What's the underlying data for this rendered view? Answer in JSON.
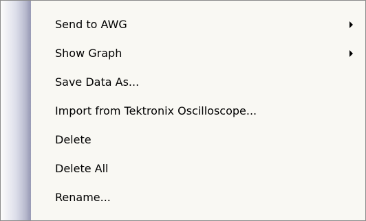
{
  "context_menu": {
    "items": [
      {
        "label": "Send to AWG",
        "has_submenu": true
      },
      {
        "label": "Show Graph",
        "has_submenu": true
      },
      {
        "label": "Save Data As..."
      },
      {
        "label": "Import from Tektronix Oscilloscope..."
      },
      {
        "label": "Delete"
      },
      {
        "label": "Delete All"
      },
      {
        "label": "Rename..."
      }
    ]
  },
  "icons": {
    "submenu_indicator": "chevron-right-icon"
  },
  "colors": {
    "menu_background": "#f9f8f3",
    "menu_border": "#8a8a8a",
    "gutter_edge": "#9a9cb6",
    "text": "#000000"
  }
}
